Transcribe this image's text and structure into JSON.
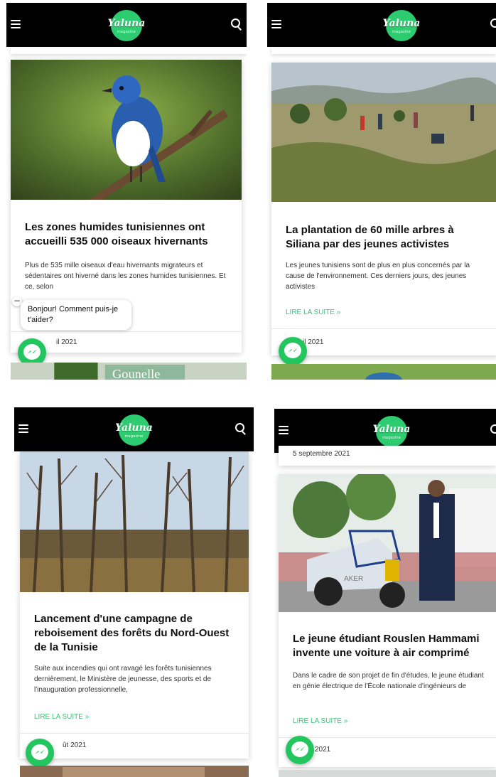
{
  "brand": {
    "logo_text": "Yaluna",
    "logo_sub": "magazine",
    "accent": "#2ecc71",
    "topbar_color": "#000000"
  },
  "icons": {
    "menu": "hamburger-menu-icon",
    "search": "search-icon",
    "messenger": "messenger-icon"
  },
  "chat": {
    "greeting": "Bonjour! Comment puis-je t'aider?",
    "minimize": "−"
  },
  "panels": [
    {
      "title": "Les zones humides tunisiennes ont accueilli 535 000 oiseaux hivernants",
      "excerpt": "Plus de 535 mille oiseaux d'eau hivernants migrateurs et sédentaires ont hiverné dans les zones humides tunisiennes. Et ce, selon",
      "date": "avril 2021",
      "date_visible": "il 2021"
    },
    {
      "title": "La plantation de 60 mille arbres à Siliana par des jeunes activistes",
      "excerpt": "Les jeunes tunisiens sont de plus en plus concernés par la cause de l'environnement. Ces derniers jours, des jeunes activistes",
      "read_more": "LIRE LA SUITE »",
      "date_visible": "il 2021"
    },
    {
      "title": "Lancement d'une campagne de reboisement des forêts du Nord-Ouest de la Tunisie",
      "excerpt": "Suite aux incendies qui ont ravagé les forêts tunisiennes dernièrement, le Ministère de jeunesse, des sports et de l'inauguration professionnelle,",
      "read_more": "LIRE LA SUITE »",
      "date_visible": "ût 2021"
    },
    {
      "top_date": "5 septembre 2021",
      "title": "Le jeune étudiant Rouslen Hammami invente une voiture à air comprimé",
      "excerpt": "Dans le cadre de son projet de fin d'études, le jeune étudiant en génie électrique de l'École nationale d'ingénieurs de",
      "read_more": "LIRE LA SUITE »",
      "date_visible": "i 2021",
      "car_label": "AKER"
    }
  ],
  "next_teaser_text": "Gounelle"
}
